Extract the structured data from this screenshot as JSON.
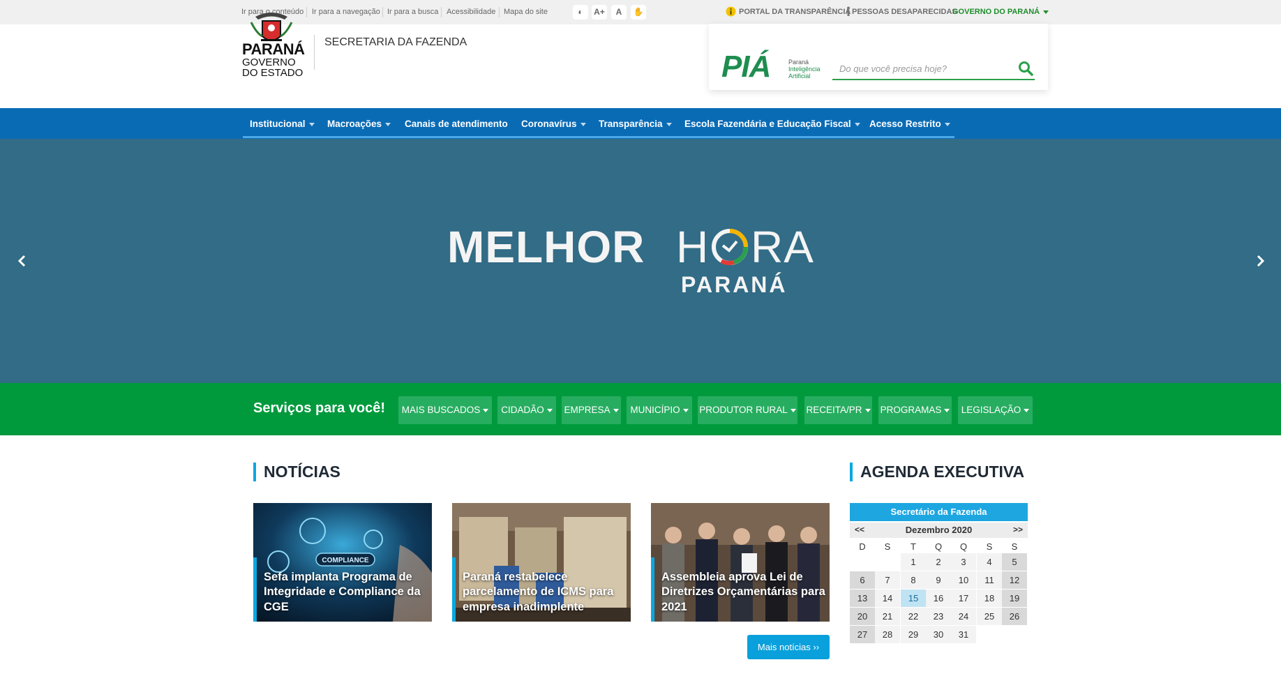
{
  "topbar": {
    "skip_links": [
      "Ir para o conteúdo",
      "Ir para a navegação",
      "Ir para a busca",
      "Acessibilidade",
      "Mapa do site"
    ],
    "accessibility_buttons": [
      "◐",
      "A+",
      "A",
      "✋"
    ],
    "portal_transparencia": "PORTAL DA TRANSPARÊNCIA",
    "pessoas_desaparecidas": "PESSOAS DESAPARECIDAS",
    "governo": "GOVERNO DO PARANÁ"
  },
  "header": {
    "logo_line1": "PARANÁ",
    "logo_line2": "GOVERNO",
    "logo_line3": "DO ESTADO",
    "secretaria": "SECRETARIA DA FAZENDA",
    "pia_brand": "PIÁ",
    "pia_sub1": "Paraná",
    "pia_sub2": "Inteligência",
    "pia_sub3": "Artificial",
    "search_placeholder": "Do que você precisa hoje?"
  },
  "nav": {
    "items": [
      {
        "label": "Institucional"
      },
      {
        "label": "Macroações"
      },
      {
        "label": "Canais de atendimento"
      },
      {
        "label": "Coronavírus"
      },
      {
        "label": "Transparência"
      },
      {
        "label": "Escola Fazendária e Educação Fiscal"
      },
      {
        "label": "Acesso Restrito"
      }
    ]
  },
  "hero": {
    "word1": "MELHOR",
    "word2a": "H",
    "word2b": "RA",
    "word3": "PARANÁ"
  },
  "services": {
    "title": "Serviços para você!",
    "buttons": [
      "MAIS BUSCADOS",
      "CIDADÃO",
      "EMPRESA",
      "MUNICÍPIO",
      "PRODUTOR RURAL",
      "RECEITA/PR",
      "PROGRAMAS",
      "LEGISLAÇÃO"
    ]
  },
  "news": {
    "title": "NOTÍCIAS",
    "items": [
      {
        "title": "Sefa implanta Programa de Integridade e Compliance da CGE",
        "image_label": "COMPLIANCE"
      },
      {
        "title": "Paraná restabelece parcelamento de ICMS para empresa inadimplente"
      },
      {
        "title": "Assembleia aprova Lei de Diretrizes Orçamentárias para 2021"
      }
    ],
    "more_label": "Mais notícias ››"
  },
  "agenda": {
    "title": "AGENDA EXECUTIVA",
    "subtitle": "Secretário da Fazenda",
    "prev": "<<",
    "next": ">>",
    "month": "Dezembro 2020",
    "dow": [
      "D",
      "S",
      "T",
      "Q",
      "Q",
      "S",
      "S"
    ],
    "today": 15,
    "weeks": [
      [
        "",
        "",
        "1",
        "2",
        "3",
        "4",
        "5"
      ],
      [
        "6",
        "7",
        "8",
        "9",
        "10",
        "11",
        "12"
      ],
      [
        "13",
        "14",
        "15",
        "16",
        "17",
        "18",
        "19"
      ],
      [
        "20",
        "21",
        "22",
        "23",
        "24",
        "25",
        "26"
      ],
      [
        "27",
        "28",
        "29",
        "30",
        "31",
        "",
        ""
      ]
    ]
  },
  "colors": {
    "nav_blue": "#0a6bb5",
    "services_green": "#009a3d",
    "hero_teal": "#326c86",
    "accent_cyan": "#0aa8e0"
  }
}
